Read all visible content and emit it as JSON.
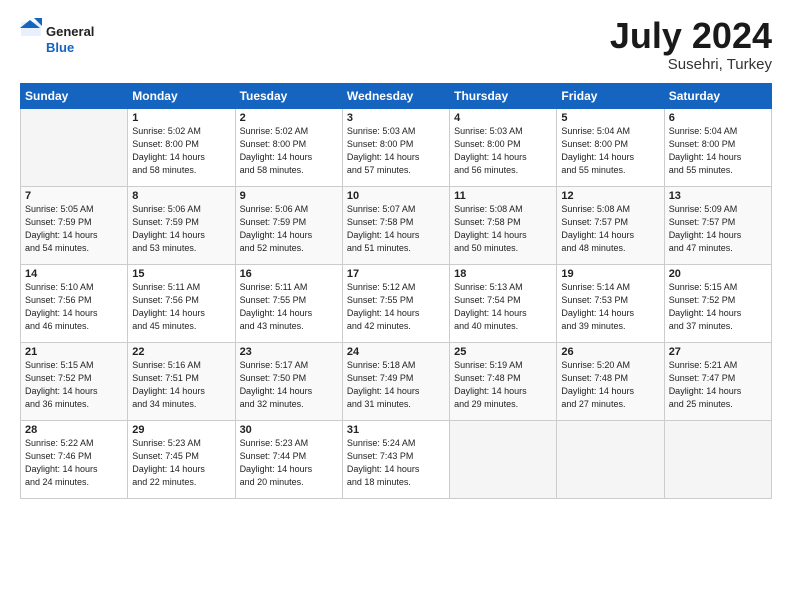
{
  "header": {
    "logo_general": "General",
    "logo_blue": "Blue",
    "month_year": "July 2024",
    "location": "Susehri, Turkey"
  },
  "weekdays": [
    "Sunday",
    "Monday",
    "Tuesday",
    "Wednesday",
    "Thursday",
    "Friday",
    "Saturday"
  ],
  "weeks": [
    [
      {
        "day": "",
        "info": ""
      },
      {
        "day": "1",
        "info": "Sunrise: 5:02 AM\nSunset: 8:00 PM\nDaylight: 14 hours\nand 58 minutes."
      },
      {
        "day": "2",
        "info": "Sunrise: 5:02 AM\nSunset: 8:00 PM\nDaylight: 14 hours\nand 58 minutes."
      },
      {
        "day": "3",
        "info": "Sunrise: 5:03 AM\nSunset: 8:00 PM\nDaylight: 14 hours\nand 57 minutes."
      },
      {
        "day": "4",
        "info": "Sunrise: 5:03 AM\nSunset: 8:00 PM\nDaylight: 14 hours\nand 56 minutes."
      },
      {
        "day": "5",
        "info": "Sunrise: 5:04 AM\nSunset: 8:00 PM\nDaylight: 14 hours\nand 55 minutes."
      },
      {
        "day": "6",
        "info": "Sunrise: 5:04 AM\nSunset: 8:00 PM\nDaylight: 14 hours\nand 55 minutes."
      }
    ],
    [
      {
        "day": "7",
        "info": "Sunrise: 5:05 AM\nSunset: 7:59 PM\nDaylight: 14 hours\nand 54 minutes."
      },
      {
        "day": "8",
        "info": "Sunrise: 5:06 AM\nSunset: 7:59 PM\nDaylight: 14 hours\nand 53 minutes."
      },
      {
        "day": "9",
        "info": "Sunrise: 5:06 AM\nSunset: 7:59 PM\nDaylight: 14 hours\nand 52 minutes."
      },
      {
        "day": "10",
        "info": "Sunrise: 5:07 AM\nSunset: 7:58 PM\nDaylight: 14 hours\nand 51 minutes."
      },
      {
        "day": "11",
        "info": "Sunrise: 5:08 AM\nSunset: 7:58 PM\nDaylight: 14 hours\nand 50 minutes."
      },
      {
        "day": "12",
        "info": "Sunrise: 5:08 AM\nSunset: 7:57 PM\nDaylight: 14 hours\nand 48 minutes."
      },
      {
        "day": "13",
        "info": "Sunrise: 5:09 AM\nSunset: 7:57 PM\nDaylight: 14 hours\nand 47 minutes."
      }
    ],
    [
      {
        "day": "14",
        "info": "Sunrise: 5:10 AM\nSunset: 7:56 PM\nDaylight: 14 hours\nand 46 minutes."
      },
      {
        "day": "15",
        "info": "Sunrise: 5:11 AM\nSunset: 7:56 PM\nDaylight: 14 hours\nand 45 minutes."
      },
      {
        "day": "16",
        "info": "Sunrise: 5:11 AM\nSunset: 7:55 PM\nDaylight: 14 hours\nand 43 minutes."
      },
      {
        "day": "17",
        "info": "Sunrise: 5:12 AM\nSunset: 7:55 PM\nDaylight: 14 hours\nand 42 minutes."
      },
      {
        "day": "18",
        "info": "Sunrise: 5:13 AM\nSunset: 7:54 PM\nDaylight: 14 hours\nand 40 minutes."
      },
      {
        "day": "19",
        "info": "Sunrise: 5:14 AM\nSunset: 7:53 PM\nDaylight: 14 hours\nand 39 minutes."
      },
      {
        "day": "20",
        "info": "Sunrise: 5:15 AM\nSunset: 7:52 PM\nDaylight: 14 hours\nand 37 minutes."
      }
    ],
    [
      {
        "day": "21",
        "info": "Sunrise: 5:15 AM\nSunset: 7:52 PM\nDaylight: 14 hours\nand 36 minutes."
      },
      {
        "day": "22",
        "info": "Sunrise: 5:16 AM\nSunset: 7:51 PM\nDaylight: 14 hours\nand 34 minutes."
      },
      {
        "day": "23",
        "info": "Sunrise: 5:17 AM\nSunset: 7:50 PM\nDaylight: 14 hours\nand 32 minutes."
      },
      {
        "day": "24",
        "info": "Sunrise: 5:18 AM\nSunset: 7:49 PM\nDaylight: 14 hours\nand 31 minutes."
      },
      {
        "day": "25",
        "info": "Sunrise: 5:19 AM\nSunset: 7:48 PM\nDaylight: 14 hours\nand 29 minutes."
      },
      {
        "day": "26",
        "info": "Sunrise: 5:20 AM\nSunset: 7:48 PM\nDaylight: 14 hours\nand 27 minutes."
      },
      {
        "day": "27",
        "info": "Sunrise: 5:21 AM\nSunset: 7:47 PM\nDaylight: 14 hours\nand 25 minutes."
      }
    ],
    [
      {
        "day": "28",
        "info": "Sunrise: 5:22 AM\nSunset: 7:46 PM\nDaylight: 14 hours\nand 24 minutes."
      },
      {
        "day": "29",
        "info": "Sunrise: 5:23 AM\nSunset: 7:45 PM\nDaylight: 14 hours\nand 22 minutes."
      },
      {
        "day": "30",
        "info": "Sunrise: 5:23 AM\nSunset: 7:44 PM\nDaylight: 14 hours\nand 20 minutes."
      },
      {
        "day": "31",
        "info": "Sunrise: 5:24 AM\nSunset: 7:43 PM\nDaylight: 14 hours\nand 18 minutes."
      },
      {
        "day": "",
        "info": ""
      },
      {
        "day": "",
        "info": ""
      },
      {
        "day": "",
        "info": ""
      }
    ]
  ]
}
